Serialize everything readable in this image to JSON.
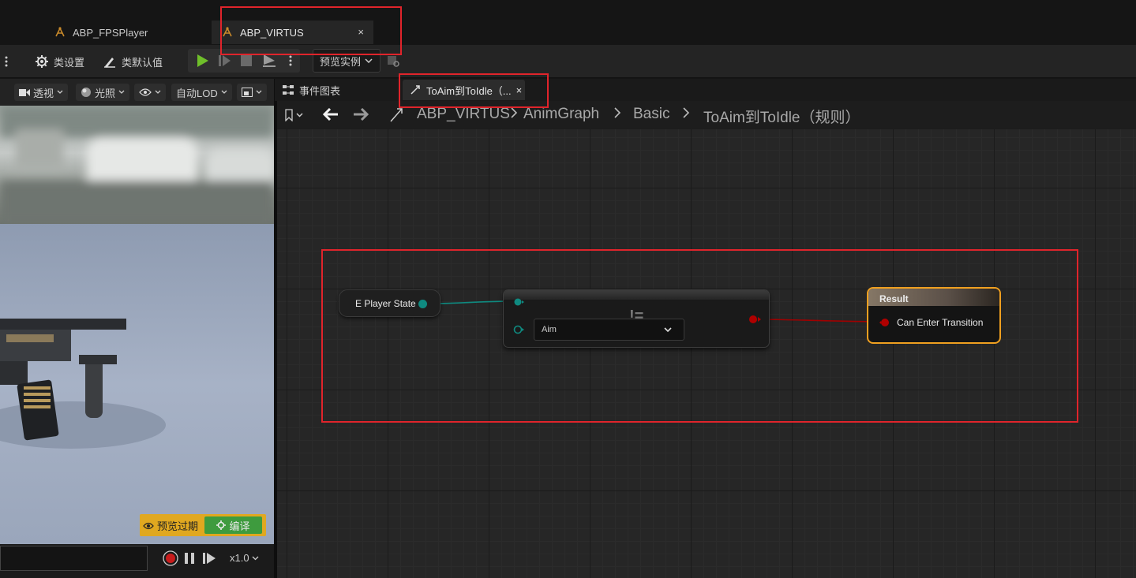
{
  "document_tabs": [
    {
      "label": "ABP_FPSPlayer",
      "active": false
    },
    {
      "label": "ABP_VIRTUS",
      "active": true,
      "close": "×"
    }
  ],
  "toolbar": {
    "class_settings": "类设置",
    "class_defaults": "类默认值",
    "preview_instance": "预览实例"
  },
  "viewport": {
    "perspective": "透视",
    "lighting": "光照",
    "lod": "自动LOD",
    "preview_warning": "预览过期",
    "compile": "编译",
    "speed": "x1.0"
  },
  "graph_tabs": [
    {
      "label": "事件图表"
    },
    {
      "label": "ToAim到ToIdle（...",
      "close": "×"
    }
  ],
  "breadcrumb": [
    "ABP_VIRTUS",
    "AnimGraph",
    "Basic",
    "ToAim到ToIdle（规则）"
  ],
  "nodes": {
    "variable": "E Player State",
    "equal_operator": "!=",
    "enum_value": "Aim",
    "result_title": "Result",
    "result_pin": "Can Enter Transition"
  },
  "colors": {
    "enum_pin": "#0f8a80",
    "bool_pin": "#b00000",
    "result_border": "#f0a020",
    "highlight_box": "#e0242b",
    "play_green": "#6fbf2a"
  }
}
